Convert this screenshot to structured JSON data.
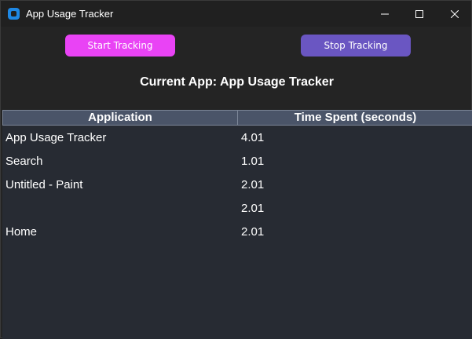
{
  "window": {
    "title": "App Usage Tracker",
    "controls": {
      "minimize": "minimize-icon",
      "maximize": "maximize-icon",
      "close": "close-icon"
    }
  },
  "toolbar": {
    "start_label": "Start Tracking",
    "stop_label": "Stop Tracking",
    "start_color": "#e943f5",
    "stop_color": "#6a56c2"
  },
  "status": {
    "current_app": "Current App: App Usage Tracker"
  },
  "table": {
    "columns": [
      "Application",
      "Time Spent (seconds)"
    ],
    "rows": [
      {
        "app": "App Usage Tracker",
        "time": "4.01"
      },
      {
        "app": "Search",
        "time": "1.01"
      },
      {
        "app": "Untitled - Paint",
        "time": "2.01"
      },
      {
        "app": "",
        "time": "2.01"
      },
      {
        "app": "Home",
        "time": "2.01"
      }
    ]
  }
}
